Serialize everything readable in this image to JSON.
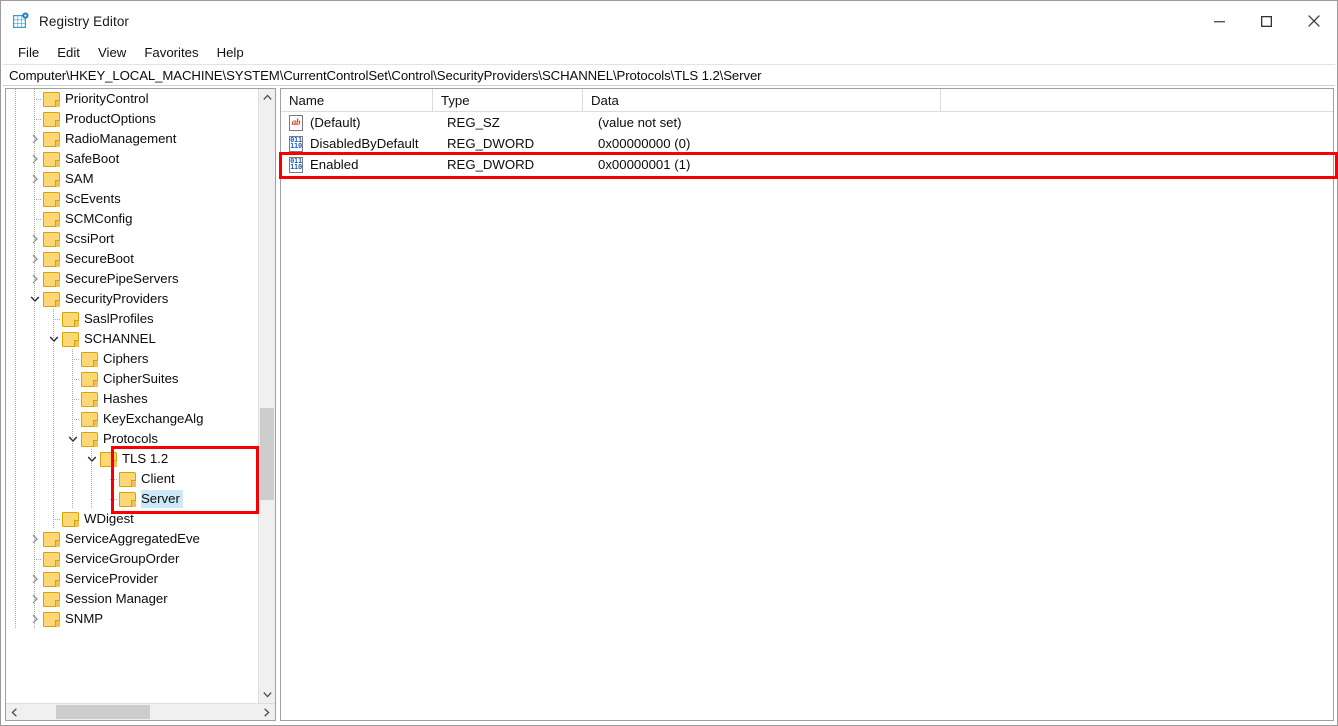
{
  "window": {
    "title": "Registry Editor",
    "app_icon": "registry-editor-icon",
    "controls": {
      "minimize": "minimize",
      "maximize": "maximize",
      "close": "close"
    }
  },
  "menubar": {
    "items": [
      {
        "label": "File"
      },
      {
        "label": "Edit"
      },
      {
        "label": "View"
      },
      {
        "label": "Favorites"
      },
      {
        "label": "Help"
      }
    ]
  },
  "address": {
    "path": "Computer\\HKEY_LOCAL_MACHINE\\SYSTEM\\CurrentControlSet\\Control\\SecurityProviders\\SCHANNEL\\Protocols\\TLS 1.2\\Server"
  },
  "tree": {
    "nodes": [
      {
        "label": "PriorityControl",
        "depth": 3,
        "twisty": "none",
        "selected": false
      },
      {
        "label": "ProductOptions",
        "depth": 3,
        "twisty": "none",
        "selected": false
      },
      {
        "label": "RadioManagement",
        "depth": 3,
        "twisty": "collapsed",
        "selected": false
      },
      {
        "label": "SafeBoot",
        "depth": 3,
        "twisty": "collapsed",
        "selected": false
      },
      {
        "label": "SAM",
        "depth": 3,
        "twisty": "collapsed",
        "selected": false
      },
      {
        "label": "ScEvents",
        "depth": 3,
        "twisty": "none",
        "selected": false
      },
      {
        "label": "SCMConfig",
        "depth": 3,
        "twisty": "none",
        "selected": false
      },
      {
        "label": "ScsiPort",
        "depth": 3,
        "twisty": "collapsed",
        "selected": false
      },
      {
        "label": "SecureBoot",
        "depth": 3,
        "twisty": "collapsed",
        "selected": false
      },
      {
        "label": "SecurePipeServers",
        "depth": 3,
        "twisty": "collapsed",
        "selected": false
      },
      {
        "label": "SecurityProviders",
        "depth": 3,
        "twisty": "expanded",
        "selected": false
      },
      {
        "label": "SaslProfiles",
        "depth": 4,
        "twisty": "none",
        "selected": false
      },
      {
        "label": "SCHANNEL",
        "depth": 4,
        "twisty": "expanded",
        "selected": false
      },
      {
        "label": "Ciphers",
        "depth": 5,
        "twisty": "none",
        "selected": false
      },
      {
        "label": "CipherSuites",
        "depth": 5,
        "twisty": "none",
        "selected": false
      },
      {
        "label": "Hashes",
        "depth": 5,
        "twisty": "none",
        "selected": false
      },
      {
        "label": "KeyExchangeAlg",
        "depth": 5,
        "twisty": "none",
        "selected": false
      },
      {
        "label": "Protocols",
        "depth": 5,
        "twisty": "expanded",
        "selected": false
      },
      {
        "label": "TLS 1.2",
        "depth": 6,
        "twisty": "expanded",
        "selected": false
      },
      {
        "label": "Client",
        "depth": 7,
        "twisty": "none",
        "selected": false
      },
      {
        "label": "Server",
        "depth": 7,
        "twisty": "none",
        "selected": true
      },
      {
        "label": "WDigest",
        "depth": 4,
        "twisty": "none",
        "selected": false
      },
      {
        "label": "ServiceAggregatedEve",
        "depth": 3,
        "twisty": "collapsed",
        "selected": false
      },
      {
        "label": "ServiceGroupOrder",
        "depth": 3,
        "twisty": "none",
        "selected": false
      },
      {
        "label": "ServiceProvider",
        "depth": 3,
        "twisty": "collapsed",
        "selected": false
      },
      {
        "label": "Session Manager",
        "depth": 3,
        "twisty": "collapsed",
        "selected": false
      },
      {
        "label": "SNMP",
        "depth": 3,
        "twisty": "collapsed",
        "selected": false
      }
    ],
    "scrollbar": {
      "up_arrow": "chevron-up-icon",
      "down_arrow": "chevron-down-icon",
      "left_arrow": "chevron-left-icon",
      "right_arrow": "chevron-right-icon"
    }
  },
  "values": {
    "columns": [
      {
        "label": "Name"
      },
      {
        "label": "Type"
      },
      {
        "label": "Data"
      }
    ],
    "rows": [
      {
        "name": "(Default)",
        "type": "REG_SZ",
        "data": "(value not set)",
        "icon": "string-value-icon",
        "icon_glyph": "ab",
        "highlighted": false
      },
      {
        "name": "DisabledByDefault",
        "type": "REG_DWORD",
        "data": "0x00000000 (0)",
        "icon": "dword-value-icon",
        "icon_glyph": "011",
        "highlighted": false
      },
      {
        "name": "Enabled",
        "type": "REG_DWORD",
        "data": "0x00000001 (1)",
        "icon": "dword-value-icon",
        "icon_glyph": "011",
        "highlighted": true
      }
    ]
  },
  "annotations": {
    "highlight_color": "#f80000",
    "boxes": [
      {
        "name": "enabled-row-highlight",
        "target": "Enabled"
      },
      {
        "name": "tls12-subtree-highlight",
        "target": "TLS 1.2"
      }
    ]
  },
  "colors": {
    "selection": "#cde8f7",
    "folder": "#fbd775",
    "accent_red": "#f80000",
    "dword_blue": "#1f5fc4",
    "string_red": "#d93a1e"
  }
}
